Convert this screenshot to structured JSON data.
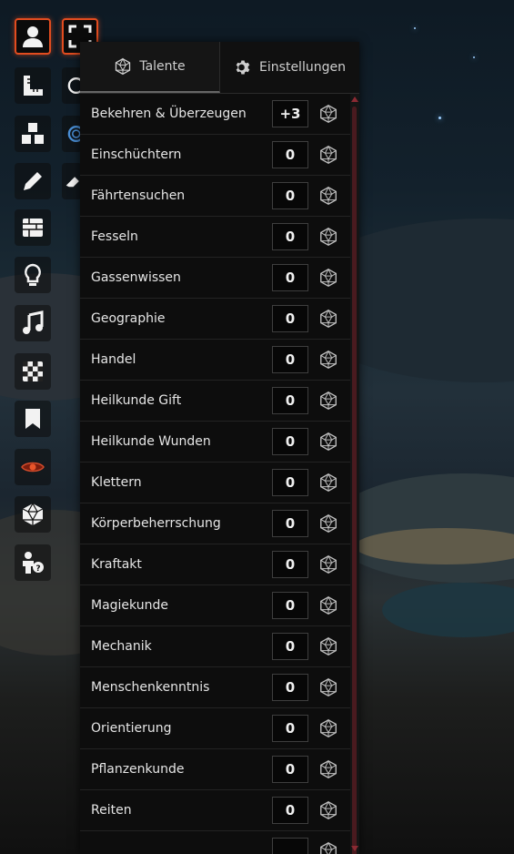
{
  "toolbar": {
    "tools": [
      {
        "name": "user-icon",
        "active": true
      },
      {
        "name": "fullscreen-icon",
        "active": true
      },
      {
        "name": "ruler-icon"
      },
      {
        "name": "target-icon"
      },
      {
        "name": "cubes-icon"
      },
      {
        "name": "target-blue-icon"
      },
      {
        "name": "pencil-icon"
      },
      {
        "name": "eraser-icon"
      },
      {
        "name": "brick-wall-icon"
      },
      {
        "name": "lightbulb-icon"
      },
      {
        "name": "music-icon"
      },
      {
        "name": "checkerboard-icon"
      },
      {
        "name": "bookmark-icon"
      },
      {
        "name": "eye-icon"
      },
      {
        "name": "d20-icon"
      },
      {
        "name": "user-help-icon"
      }
    ]
  },
  "tabs": {
    "talente": "Talente",
    "einstellungen": "Einstellungen"
  },
  "skills": [
    {
      "name": "Bekehren & Überzeugen",
      "value": "+3"
    },
    {
      "name": "Einschüchtern",
      "value": "0"
    },
    {
      "name": "Fährtensuchen",
      "value": "0"
    },
    {
      "name": "Fesseln",
      "value": "0"
    },
    {
      "name": "Gassenwissen",
      "value": "0"
    },
    {
      "name": "Geographie",
      "value": "0"
    },
    {
      "name": "Handel",
      "value": "0"
    },
    {
      "name": "Heilkunde Gift",
      "value": "0"
    },
    {
      "name": "Heilkunde Wunden",
      "value": "0"
    },
    {
      "name": "Klettern",
      "value": "0"
    },
    {
      "name": "Körperbeherrschung",
      "value": "0"
    },
    {
      "name": "Kraftakt",
      "value": "0"
    },
    {
      "name": "Magiekunde",
      "value": "0"
    },
    {
      "name": "Mechanik",
      "value": "0"
    },
    {
      "name": "Menschenkenntnis",
      "value": "0"
    },
    {
      "name": "Orientierung",
      "value": "0"
    },
    {
      "name": "Pflanzenkunde",
      "value": "0"
    },
    {
      "name": "Reiten",
      "value": "0"
    },
    {
      "name": "",
      "value": ""
    }
  ],
  "colors": {
    "accent": "#e24c1f",
    "scroll_thumb": "#4a1a1f"
  }
}
